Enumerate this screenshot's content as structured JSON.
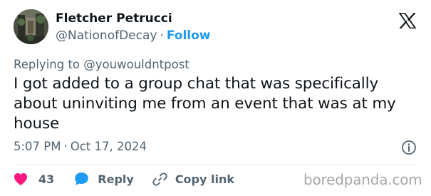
{
  "author": {
    "name": "Fletcher Petrucci",
    "handle": "@NationofDecay",
    "separator": "·",
    "follow_label": "Follow"
  },
  "tweet": {
    "replying_prefix": "Replying to",
    "replying_handle": "@youwouldntpost",
    "text": "I got added to a group chat that was specifically about uninviting me from an event that was at my house",
    "time": "5:07 PM",
    "separator": "·",
    "date": "Oct 17, 2024"
  },
  "actions": {
    "like_count": "43",
    "reply_label": "Reply",
    "copy_link_label": "Copy link"
  },
  "watermark": "boredpanda.com",
  "colors": {
    "like": "#f91880",
    "reply": "#1d9bf0",
    "follow": "#1d9bf0",
    "secondary_text": "#536471",
    "primary_text": "#0f1419"
  },
  "icons": {
    "platform": "x-logo-icon",
    "info": "info-icon",
    "like": "heart-icon",
    "reply": "speech-bubble-icon",
    "copy_link": "link-icon"
  }
}
